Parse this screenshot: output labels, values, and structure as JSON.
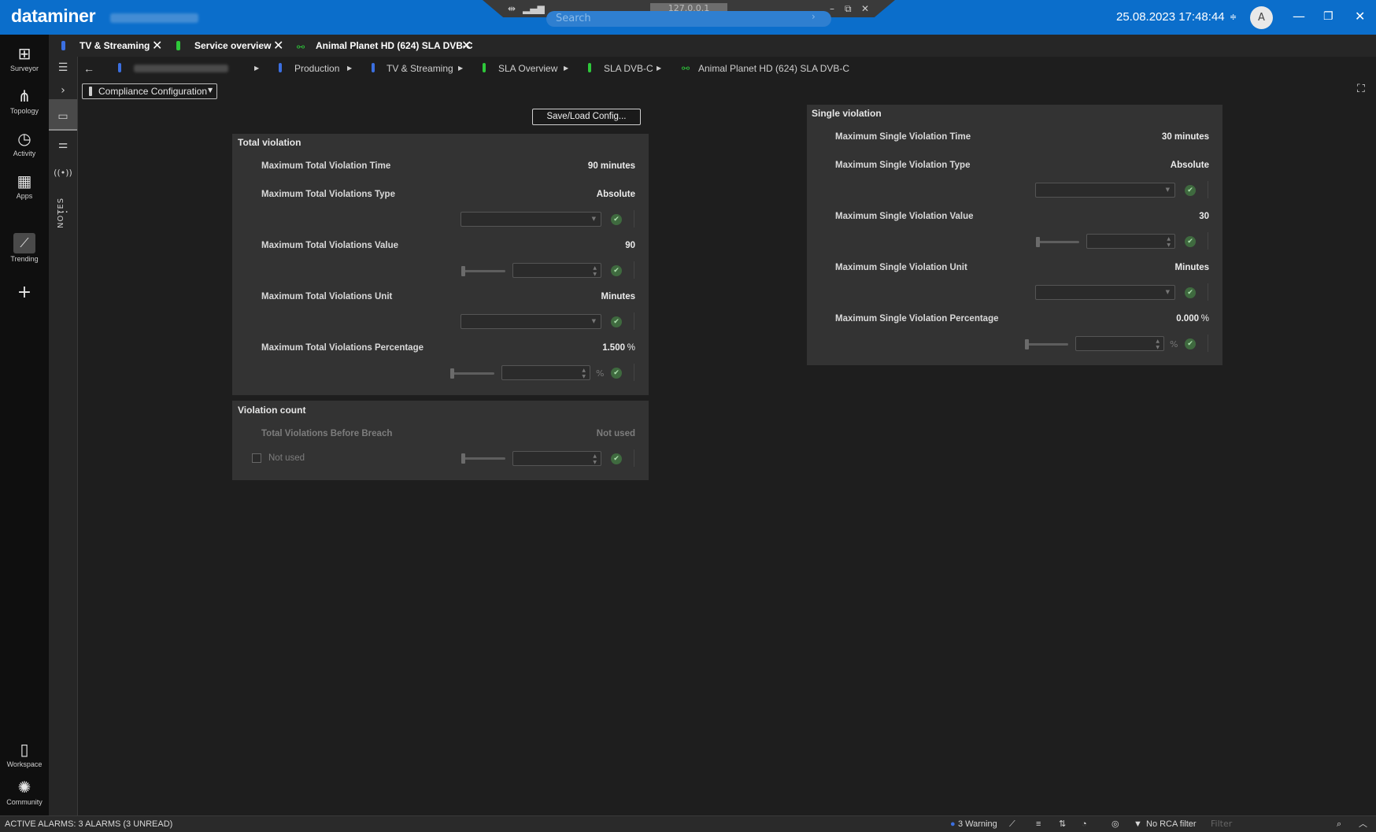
{
  "app": {
    "logo": "dataminer",
    "datetime": "25.08.2023 17:48:44",
    "avatar_initial": "A",
    "connection_ip": "127.0.0.1",
    "search_placeholder": "Search"
  },
  "rail": {
    "items": [
      {
        "label": "Surveyor",
        "icon": "surveyor-icon"
      },
      {
        "label": "Topology",
        "icon": "topology-icon"
      },
      {
        "label": "Activity",
        "icon": "activity-icon"
      },
      {
        "label": "Apps",
        "icon": "apps-icon"
      },
      {
        "label": "Trending",
        "icon": "trending-icon"
      }
    ],
    "bottom": [
      {
        "label": "Workspace",
        "icon": "workspace-icon"
      },
      {
        "label": "Community",
        "icon": "community-icon"
      }
    ]
  },
  "rail2": {
    "notes_label": "NOTES"
  },
  "tabs": [
    {
      "label": "TV & Streaming",
      "color": "#3b6fe0"
    },
    {
      "label": "Service overview",
      "color": "#2ec83a"
    },
    {
      "label": "Animal Planet HD (624) SLA DVB-C",
      "color": "#2ec83a"
    }
  ],
  "breadcrumb": [
    {
      "label": "Production",
      "color": "#3b6fe0"
    },
    {
      "label": "TV & Streaming",
      "color": "#3b6fe0"
    },
    {
      "label": "SLA Overview",
      "color": "#2ec83a"
    },
    {
      "label": "SLA DVB-C",
      "color": "#2ec83a"
    },
    {
      "label": "Animal Planet HD (624) SLA DVB-C",
      "color": "#2ec83a"
    }
  ],
  "page_selector": "Compliance Configuration",
  "save_load_label": "Save/Load Config...",
  "total_violation": {
    "title": "Total violation",
    "time_label": "Maximum Total Violation Time",
    "time_value": "90 minutes",
    "type_label": "Maximum Total Violations Type",
    "type_value": "Absolute",
    "value_label": "Maximum Total Violations Value",
    "value_value": "90",
    "unit_label": "Maximum Total Violations Unit",
    "unit_value": "Minutes",
    "pct_label": "Maximum Total Violations Percentage",
    "pct_value": "1.500",
    "pct_unit": "%"
  },
  "violation_count": {
    "title": "Violation count",
    "before_label": "Total Violations Before Breach",
    "before_value": "Not used",
    "checkbox_label": "Not used"
  },
  "single_violation": {
    "title": "Single violation",
    "time_label": "Maximum Single Violation Time",
    "time_value": "30 minutes",
    "type_label": "Maximum Single Violation Type",
    "type_value": "Absolute",
    "value_label": "Maximum Single Violation Value",
    "value_value": "30",
    "unit_label": "Maximum Single Violation Unit",
    "unit_value": "Minutes",
    "pct_label": "Maximum Single Violation Percentage",
    "pct_value": "0.000",
    "pct_unit": "%"
  },
  "statusbar": {
    "alarms": "ACTIVE ALARMS: 3 ALARMS (3 UNREAD)",
    "warning": "3 Warning",
    "rca_filter": "No RCA filter",
    "filter_placeholder": "Filter"
  },
  "colors": {
    "accent": "#0b6ecb",
    "ok_check": "#3f6a3f"
  }
}
